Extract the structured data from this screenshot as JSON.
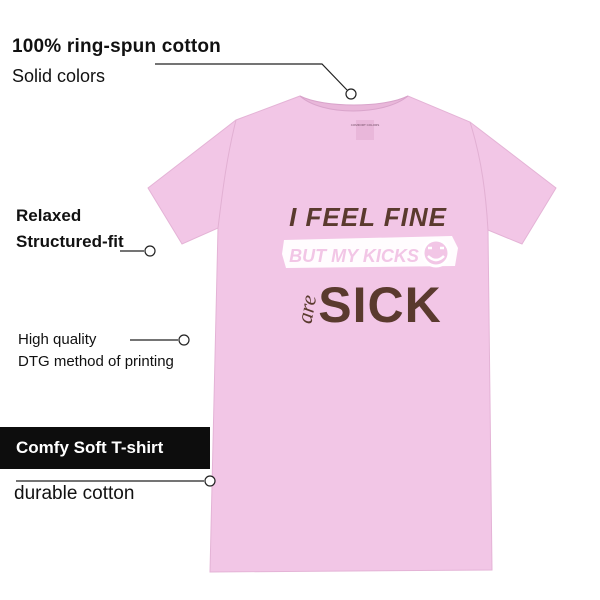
{
  "features": [
    {
      "title": "100% ring-spun cotton",
      "subtitle": "Solid colors"
    },
    {
      "title": "Relaxed",
      "subtitle": "Structured-fit"
    },
    {
      "title": "High quality",
      "subtitle": "DTG method of printing"
    },
    {
      "title": "Comfy Soft T-shirt",
      "subtitle": "durable cotton"
    }
  ],
  "shirt": {
    "color": "#f2c6e6",
    "neck_tag": "COMFORT COLORS",
    "print_line1": "I FEEL FINE",
    "print_line2": "BUT MY KICKS",
    "print_line3a": "are",
    "print_line3b": "SICK",
    "print_color": "#5a3a2e"
  }
}
